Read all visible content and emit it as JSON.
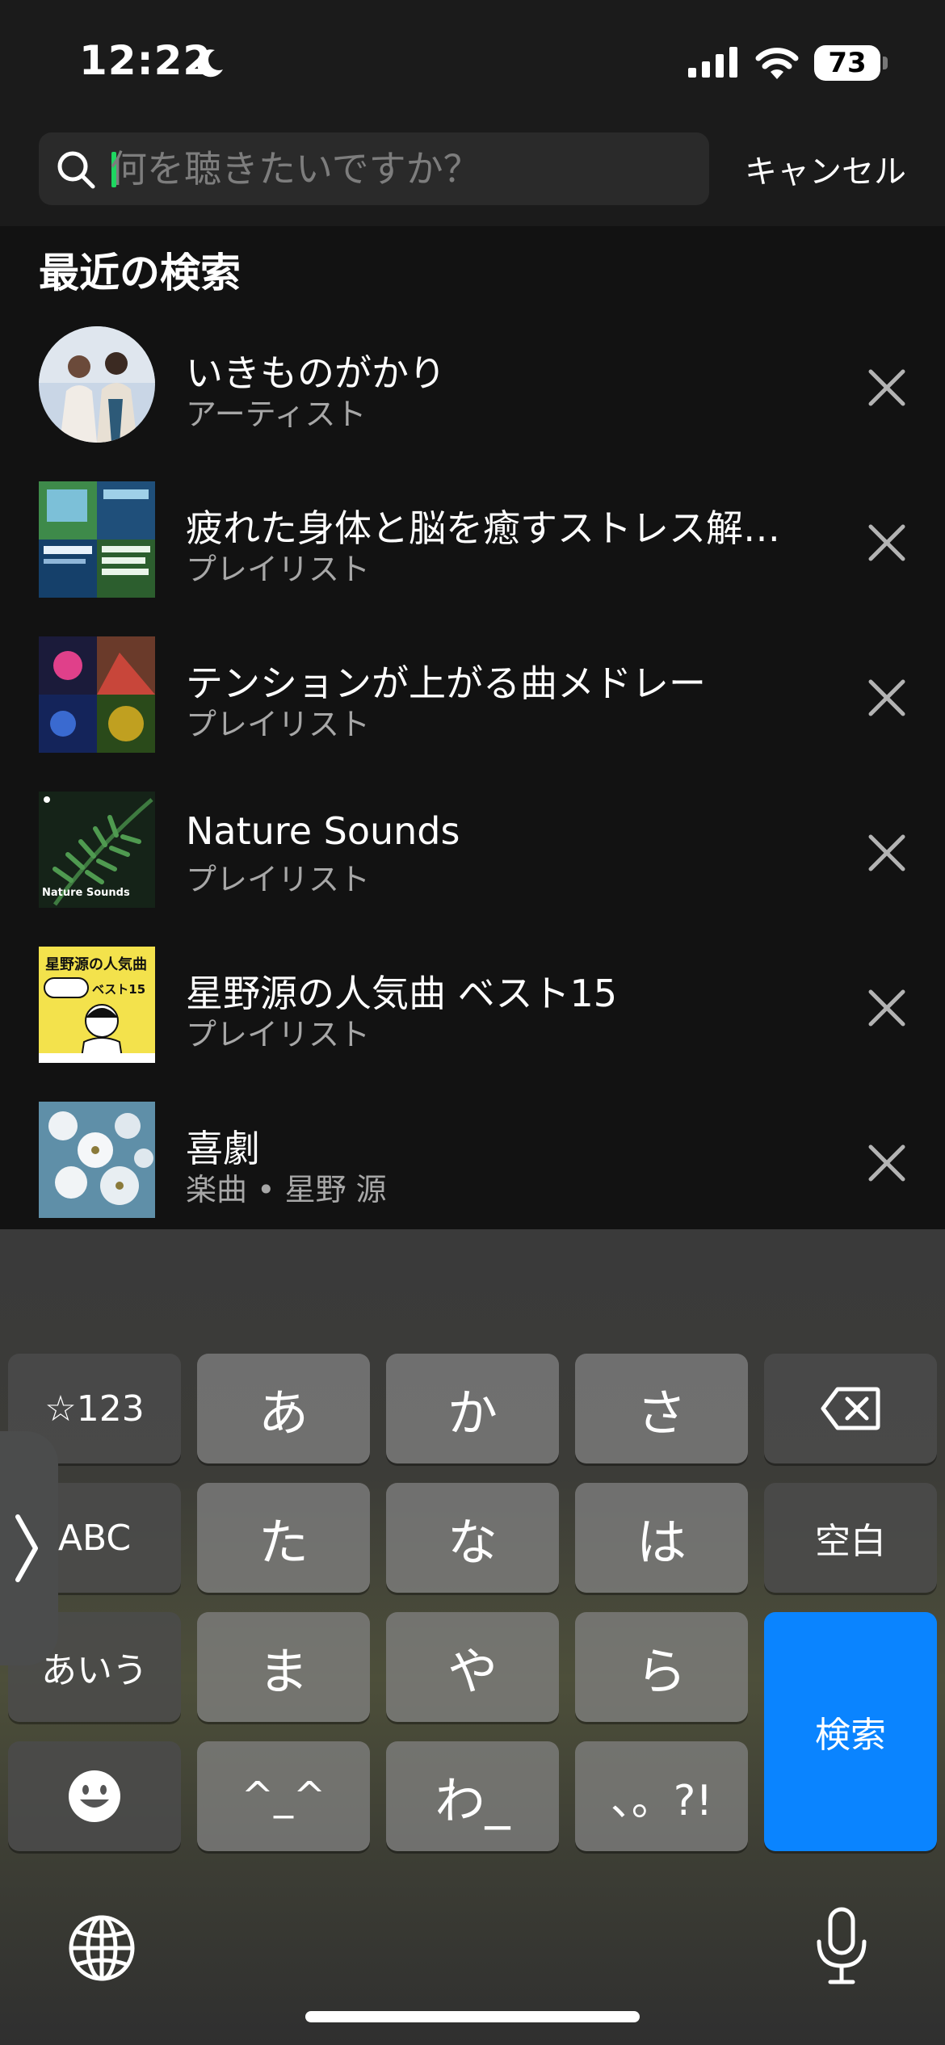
{
  "status_bar": {
    "time": "12:22",
    "battery": "73"
  },
  "search": {
    "placeholder": "何を聴きたいですか？",
    "cancel_label": "キャンセル"
  },
  "recent": {
    "title": "最近の検索",
    "items": [
      {
        "title": "いきものがかり",
        "subtitle": "アーティスト"
      },
      {
        "title": "疲れた身体と脳を癒すストレス解…",
        "subtitle": "プレイリスト"
      },
      {
        "title": "テンションが上がる曲メドレー",
        "subtitle": "プレイリスト"
      },
      {
        "title": "Nature Sounds",
        "subtitle": "プレイリスト",
        "cover_text": "Nature Sounds"
      },
      {
        "title": "星野源の人気曲 ベスト15",
        "subtitle": "プレイリスト",
        "cover_text": "星野源の人気曲",
        "cover_badge": "ベスト15"
      },
      {
        "title": "喜劇",
        "subtitle": "楽曲 • 星野 源"
      }
    ]
  },
  "keyboard": {
    "keys": {
      "numbers": "☆123",
      "a": "あ",
      "ka": "か",
      "sa": "さ",
      "abc": "ABC",
      "ta": "た",
      "na": "な",
      "ha": "は",
      "space": "空白",
      "kana": "あいう",
      "ma": "ま",
      "ya": "や",
      "ra": "ら",
      "kaomoji": "^_^",
      "wa": "わ_",
      "punct": "、。?!",
      "search": "検索"
    }
  },
  "colors": {
    "accent": "#1ed760",
    "search_key": "#0a84ff",
    "background": "#121212"
  }
}
